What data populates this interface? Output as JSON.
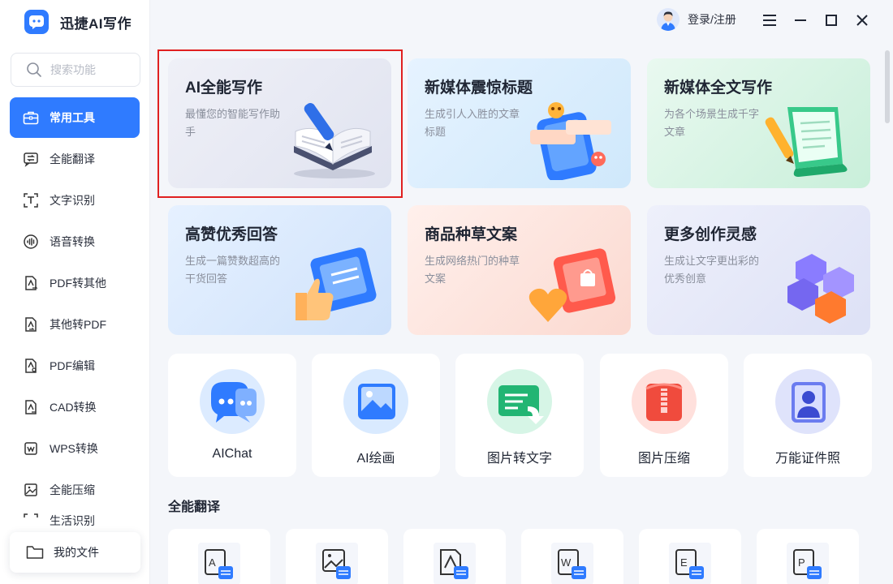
{
  "app": {
    "name": "迅捷AI写作"
  },
  "search": {
    "placeholder": "搜索功能"
  },
  "sidebar": {
    "items": [
      {
        "label": "常用工具"
      },
      {
        "label": "全能翻译"
      },
      {
        "label": "文字识别"
      },
      {
        "label": "语音转换"
      },
      {
        "label": "PDF转其他"
      },
      {
        "label": "其他转PDF"
      },
      {
        "label": "PDF编辑"
      },
      {
        "label": "CAD转换"
      },
      {
        "label": "WPS转换"
      },
      {
        "label": "全能压缩"
      },
      {
        "label": "生活识别"
      }
    ],
    "my_files": "我的文件"
  },
  "header": {
    "login_label": "登录/注册"
  },
  "cards": [
    {
      "title": "AI全能写作",
      "desc": "最懂您的智能写作助手"
    },
    {
      "title": "新媒体震惊标题",
      "desc": "生成引人入胜的文章标题"
    },
    {
      "title": "新媒体全文写作",
      "desc": "为各个场景生成千字文章"
    },
    {
      "title": "高赞优秀回答",
      "desc": "生成一篇赞数超高的干货回答"
    },
    {
      "title": "商品种草文案",
      "desc": "生成网络热门的种草文案"
    },
    {
      "title": "更多创作灵感",
      "desc": "生成让文字更出彩的优秀创意"
    }
  ],
  "tools": [
    {
      "label": "AIChat"
    },
    {
      "label": "AI绘画"
    },
    {
      "label": "图片转文字"
    },
    {
      "label": "图片压缩"
    },
    {
      "label": "万能证件照"
    }
  ],
  "translate_section": {
    "title": "全能翻译"
  },
  "colors": {
    "accent": "#2f7bff",
    "highlight": "#e02020"
  }
}
